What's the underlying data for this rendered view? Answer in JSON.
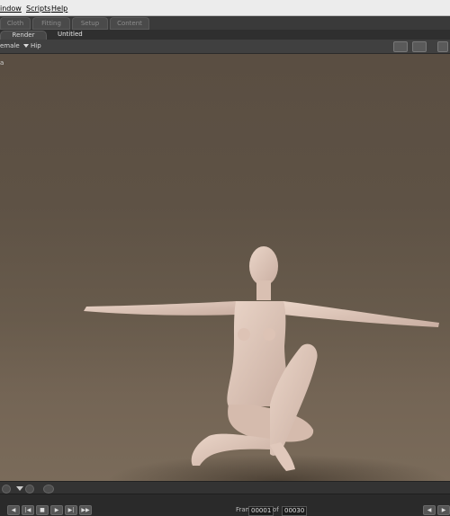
{
  "menubar": {
    "items": [
      "indow",
      "Scripts",
      "Help"
    ]
  },
  "room_tabs": [
    "Cloth",
    "Fitting",
    "Setup",
    "Content"
  ],
  "doc_tabs": {
    "render": "Render",
    "document": "Untitled"
  },
  "view_header": {
    "figure": "emale",
    "part": "Hip"
  },
  "viewport": {
    "corner_text": "a"
  },
  "timeline": {
    "frame_label": "Frame",
    "current_frame": "00001",
    "of_label": "of",
    "total_frames": "00030"
  }
}
